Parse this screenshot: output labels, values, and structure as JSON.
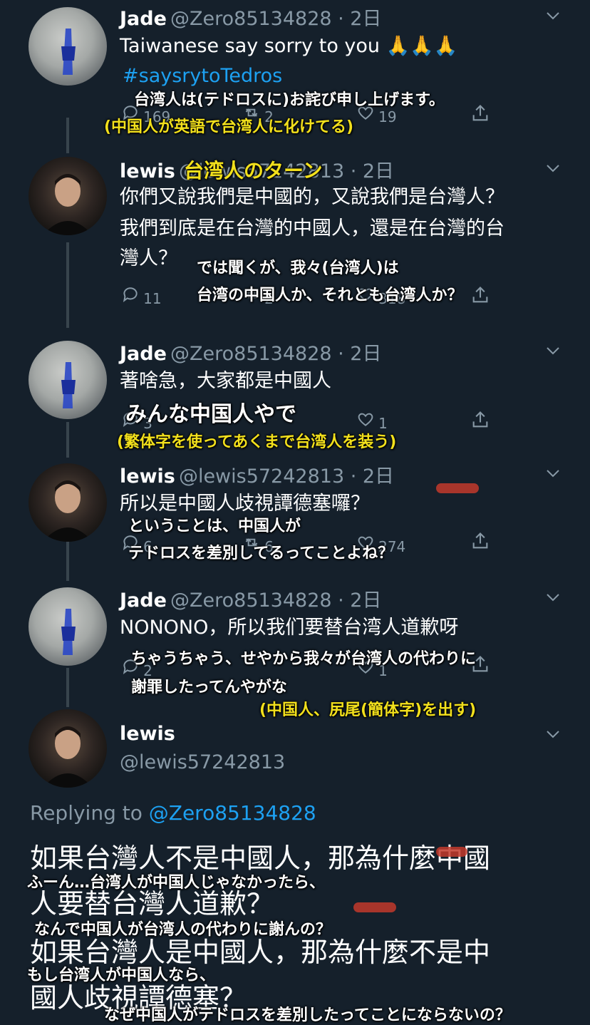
{
  "tweets": [
    {
      "name": "Jade",
      "handle": "@Zero85134828 · 2日",
      "text": "Taiwanese say sorry to you 🙏🙏🙏",
      "hashtag": "#saysrytoTedros",
      "reply_count": "169",
      "retweet_count": "2",
      "like_count": "19"
    },
    {
      "name": "lewis",
      "handle": "@lewis57242813 · 2日",
      "text_lines": [
        "你們又說我們是中國的，又說我們是台灣人？",
        "我們到底是在台灣的中國人，還是在台灣的台",
        "灣人？"
      ],
      "reply_count": "11",
      "retweet_count": "2",
      "like_count": "318"
    },
    {
      "name": "Jade",
      "handle": "@Zero85134828 · 2日",
      "text": "著啥急，大家都是中國人",
      "reply_count": "3",
      "like_count": "1"
    },
    {
      "name": "lewis",
      "handle": "@lewis57242813 · 2日",
      "text": "所以是中國人歧視譚德塞囉？",
      "reply_count": "6",
      "retweet_count": "6",
      "like_count": "274"
    },
    {
      "name": "Jade",
      "handle": "@Zero85134828 · 2日",
      "text": "NONONO，所以我们要替台湾人道歉呀",
      "reply_count": "2",
      "like_count": "1"
    },
    {
      "name": "lewis",
      "handle": "@lewis57242813"
    }
  ],
  "replying": {
    "label": "Replying to ",
    "target": "@Zero85134828"
  },
  "main_text_lines": [
    "如果台灣人不是中國人，那為什麼中國",
    "人要替台灣人道歉？",
    "如果台灣人是中國人，那為什麼不是中",
    "國人歧視譚德塞？"
  ],
  "annotations": {
    "a1": "台湾人は(テドロスに)お詫び申し上げます。",
    "a2": "(中国人が英語で台湾人に化けてる)",
    "a3": "台湾人のターン",
    "a4a": "では聞くが、我々(台湾人)は",
    "a4b": "台湾の中国人か、それとも台湾人か？",
    "a5": "みんな中国人やで",
    "a6": "(繁体字を使ってあくまで台湾人を装う)",
    "a7a": "ということは、中国人が",
    "a7b": "テドロスを差別してるってことよね？",
    "a8a": "ちゃうちゃう、せやから我々が台湾人の代わりに",
    "a8b": "謝罪したってんやがな",
    "a9": "(中国人、尻尾(簡体字)を出す)",
    "a10": "ふーん…台湾人が中国人じゃなかったら、",
    "a11": "なんで中国人が台湾人の代わりに謝んの？",
    "a12": "もし台湾人が中国人なら、",
    "a13": "なぜ中国人がテドロスを差別したってことにならないの？"
  },
  "colors": {
    "background": "#15202b",
    "secondary_text": "#8899a6",
    "link": "#1da1f2",
    "annotation_yellow": "#f2e01c"
  },
  "icons": [
    "chevron-down-icon",
    "reply-icon",
    "retweet-icon",
    "like-icon",
    "share-icon"
  ]
}
